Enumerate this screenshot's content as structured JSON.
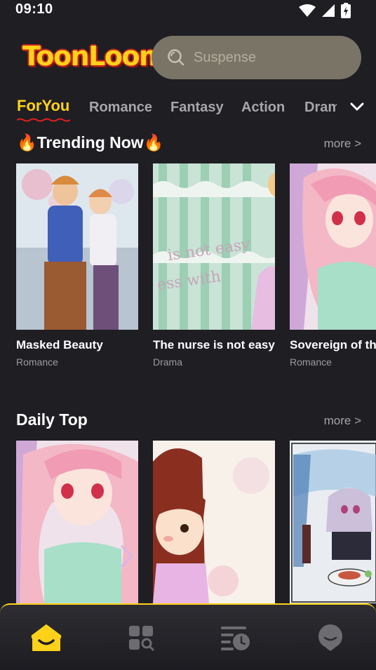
{
  "status": {
    "time": "09:10"
  },
  "header": {
    "logo_text": "ToonLoom",
    "search_placeholder": "Suspense"
  },
  "tabs": [
    {
      "label": "ForYou",
      "active": true
    },
    {
      "label": "Romance",
      "active": false
    },
    {
      "label": "Fantasy",
      "active": false
    },
    {
      "label": "Action",
      "active": false
    },
    {
      "label": "Drama",
      "active": false
    }
  ],
  "trending": {
    "title": "🔥Trending Now🔥",
    "more": "more >",
    "items": [
      {
        "title": "Masked Beauty",
        "genre": "Romance"
      },
      {
        "title": "The nurse is not easy",
        "genre": "Drama"
      },
      {
        "title": "Sovereign of the",
        "genre": "Romance"
      }
    ]
  },
  "daily": {
    "title": "Daily Top",
    "more": "more >"
  },
  "colors": {
    "accent": "#ffd21a",
    "background": "#1f1e23",
    "nav_inactive": "#6d6c71"
  },
  "nav": [
    {
      "icon": "home-icon",
      "active": true
    },
    {
      "icon": "categories-icon",
      "active": false
    },
    {
      "icon": "history-icon",
      "active": false
    },
    {
      "icon": "profile-icon",
      "active": false
    }
  ]
}
